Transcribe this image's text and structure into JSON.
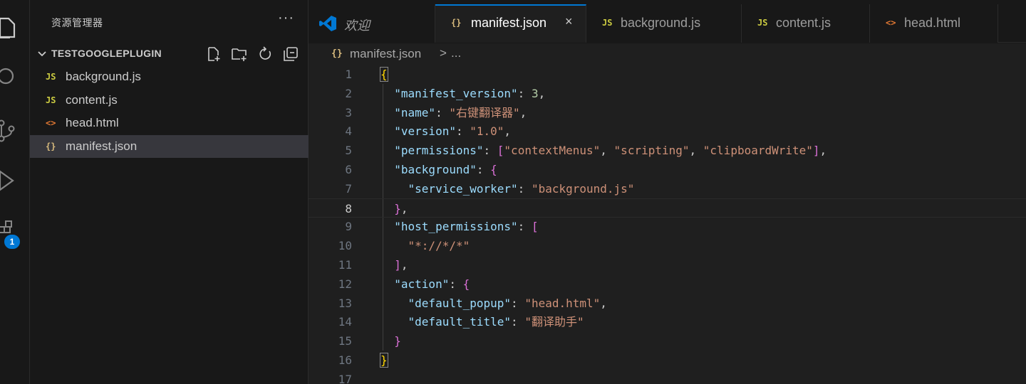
{
  "colors": {
    "js": "#cbcb41",
    "json": "#d7ba7d",
    "html": "#e37933",
    "vscode": "#0078d4"
  },
  "activity_bar": {
    "icons": [
      "explorer-icon",
      "search-icon",
      "source-control-icon",
      "run-debug-icon",
      "extensions-icon"
    ],
    "extensions_badge": "1"
  },
  "sidebar": {
    "title": "资源管理器",
    "more": "···",
    "folder": {
      "name": "TESTGOOGLEPLUGIN",
      "actions": [
        "new-file-icon",
        "new-folder-icon",
        "refresh-icon",
        "collapse-all-icon"
      ]
    },
    "files": [
      {
        "icon": "JS",
        "name": "background.js"
      },
      {
        "icon": "JS",
        "name": "content.js"
      },
      {
        "icon": "<>",
        "name": "head.html"
      },
      {
        "icon": "{}",
        "name": "manifest.json",
        "selected": true
      }
    ]
  },
  "tabs": [
    {
      "icon": "vscode-logo-icon",
      "label": "欢迎"
    },
    {
      "icon": "{}",
      "label": "manifest.json",
      "active": true,
      "close": "×"
    },
    {
      "icon": "JS",
      "label": "background.js"
    },
    {
      "icon": "JS",
      "label": "content.js"
    },
    {
      "icon": "<>",
      "label": "head.html"
    }
  ],
  "breadcrumb": {
    "icon": "{}",
    "file": "manifest.json",
    "separator": ">",
    "more": "..."
  },
  "editor": {
    "current_line": 8,
    "line_numbers": [
      "1",
      "2",
      "3",
      "4",
      "5",
      "6",
      "7",
      "8",
      "9",
      "10",
      "11",
      "12",
      "13",
      "14",
      "15",
      "16",
      "17"
    ],
    "lines": [
      "{",
      "  \"manifest_version\": 3,",
      "  \"name\": \"右键翻译器\",",
      "  \"version\": \"1.0\",",
      "  \"permissions\": [\"contextMenus\", \"scripting\", \"clipboardWrite\"],",
      "  \"background\": {",
      "    \"service_worker\": \"background.js\"",
      "  },",
      "  \"host_permissions\": [",
      "    \"*://*/*\"",
      "  ],",
      "  \"action\": {",
      "    \"default_popup\": \"head.html\",",
      "    \"default_title\": \"翻译助手\"",
      "  }",
      "}",
      ""
    ]
  }
}
